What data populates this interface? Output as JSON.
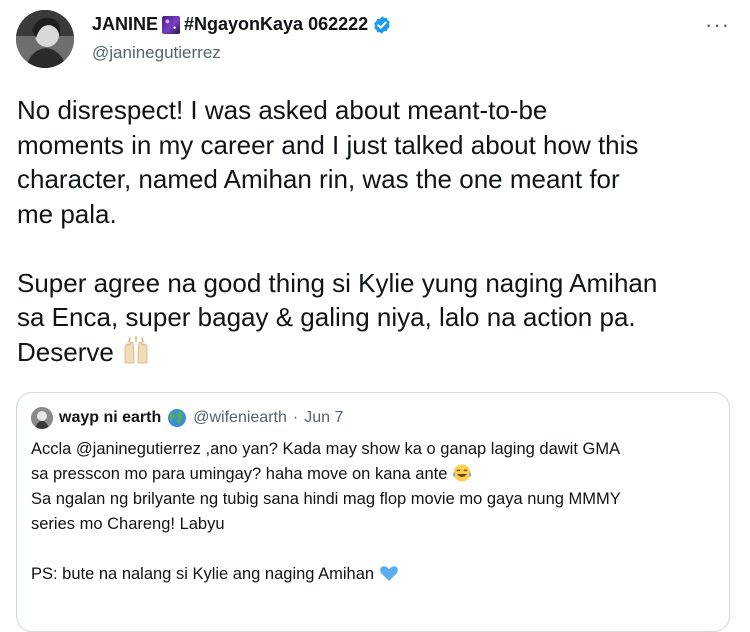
{
  "tweet": {
    "display_name": "JANINE",
    "name_tag": "#NgayonKaya 062222",
    "handle": "@janinegutierrez",
    "more_label": "···",
    "paragraph1_line1": "No disrespect! I was asked about meant-to-be",
    "paragraph1_line2": "moments in my career and I just talked about how this",
    "paragraph1_line3": "character, named Amihan rin, was the one meant for",
    "paragraph1_line4": "me pala.",
    "paragraph2_line1": "Super agree na good thing si Kylie yung naging Amihan",
    "paragraph2_line2": "sa Enca, super bagay & galing niya, lalo na action pa.",
    "paragraph2_line3": "Deserve",
    "icons": {
      "name_emoji": "galaxy-emoji",
      "verified": "verified-badge-icon",
      "deserve_emoji": "raising-hands-emoji"
    }
  },
  "quoted_tweet": {
    "display_name": "wayp ni earth",
    "handle": "@wifeniearth",
    "separator": "·",
    "date": "Jun 7",
    "line1": "Accla @janinegutierrez ,ano yan? Kada may show ka o ganap laging dawit GMA",
    "line2": "sa presscon mo para umingay? haha move on kana ante",
    "line3": "Sa ngalan ng brilyante ng tubig sana hindi mag flop movie mo gaya nung MMMY",
    "line4": "series mo Chareng! Labyu",
    "line5": "PS: bute na nalang si Kylie ang naging Amihan",
    "icons": {
      "name_emoji": "globe-emoji",
      "line2_emoji": "tears-of-joy-emoji",
      "line5_emoji": "blue-heart-emoji"
    }
  },
  "colors": {
    "text": "#0f1419",
    "secondary": "#536471",
    "verified": "#1d9bf0",
    "border": "#cfd9de"
  }
}
